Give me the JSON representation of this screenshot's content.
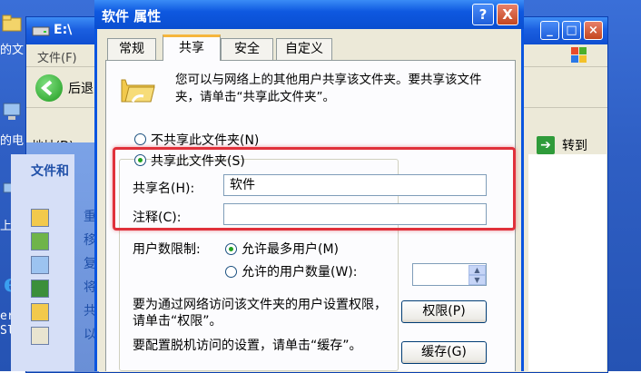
{
  "desktop": {
    "labels": [
      "的文",
      "的电",
      "上邻",
      "erra",
      "Slor"
    ],
    "icons": [
      "folder-icon",
      "computer-icon",
      "network-icon",
      "ie-icon"
    ]
  },
  "explorer": {
    "title": "E:\\",
    "menu_file": "文件(F)",
    "back_label": "后退",
    "address_label": "地址(D)",
    "go_label": "转到",
    "tasks_heading": "文件和",
    "tasks": [
      {
        "icon": "new-folder-icon",
        "text": "重"
      },
      {
        "icon": "move-icon",
        "text": "移"
      },
      {
        "icon": "copy-icon",
        "text": "复"
      },
      {
        "icon": "publish-web-icon",
        "text": "将"
      },
      {
        "icon": "share-icon",
        "text": "共"
      },
      {
        "icon": "email-icon",
        "text": "以"
      }
    ]
  },
  "dialog": {
    "title": "软件 属性",
    "help_label": "?",
    "close_label": "X",
    "tabs": [
      "常规",
      "共享",
      "安全",
      "自定义"
    ],
    "active_tab": "共享",
    "intro": "您可以与网络上的其他用户共享该文件夹。要共享该文件夹，请单击“共享此文件夹”。",
    "no_share_label": "不共享此文件夹(N)",
    "share_label": "共享此文件夹(S)",
    "share_selected": true,
    "share_name_label": "共享名(H):",
    "share_name_value": "软件",
    "comment_label": "注释(C):",
    "comment_value": "",
    "user_limit_label": "用户数限制:",
    "max_users_label": "允许最多用户(M)",
    "max_users_selected": true,
    "allowed_users_label": "允许的用户数量(W):",
    "allowed_users_value": "",
    "permissions_text": "要为通过网络访问该文件夹的用户设置权限，请单击“权限”。",
    "permissions_button": "权限(P)",
    "cache_text": "要配置脱机访问的设置，请单击“缓存”。",
    "cache_button": "缓存(G)"
  },
  "colors": {
    "highlight": "#e0313b",
    "titlebar": "#0a55e0",
    "dialog_bg": "#ece9d8"
  }
}
